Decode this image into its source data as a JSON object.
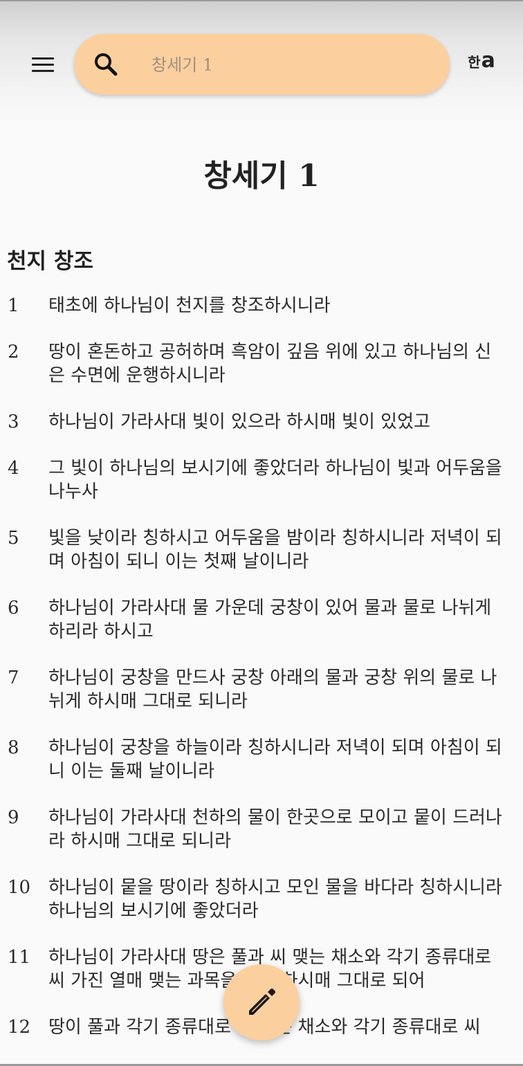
{
  "toolbar": {
    "menu_icon": "hamburger-menu-icon",
    "search_icon": "search-icon",
    "search_placeholder": "창세기 1",
    "lang_toggle_ko": "한",
    "lang_toggle_en": "a"
  },
  "chapter": {
    "title": "창세기 1",
    "section_heading": "천지 창조",
    "verses": [
      {
        "num": "1",
        "text": "태초에 하나님이 천지를 창조하시니라"
      },
      {
        "num": "2",
        "text": "땅이 혼돈하고 공허하며 흑암이 깊음 위에 있고 하나님의 신은 수면에 운행하시니라"
      },
      {
        "num": "3",
        "text": "하나님이 가라사대 빛이 있으라 하시매 빛이 있었고"
      },
      {
        "num": "4",
        "text": "그 빛이 하나님의 보시기에 좋았더라 하나님이 빛과 어두움을 나누사"
      },
      {
        "num": "5",
        "text": "빛을 낮이라 칭하시고 어두움을 밤이라 칭하시니라 저녁이 되며 아침이 되니 이는 첫째 날이니라"
      },
      {
        "num": "6",
        "text": "하나님이 가라사대 물 가운데 궁창이 있어 물과 물로 나뉘게 하리라 하시고"
      },
      {
        "num": "7",
        "text": "하나님이 궁창을 만드사 궁창 아래의 물과 궁창 위의 물로 나뉘게 하시매 그대로 되니라"
      },
      {
        "num": "8",
        "text": "하나님이 궁창을 하늘이라 칭하시니라 저녁이 되며 아침이 되니 이는 둘째 날이니라"
      },
      {
        "num": "9",
        "text": "하나님이 가라사대 천하의 물이 한곳으로 모이고 뭍이 드러나라 하시매 그대로 되니라"
      },
      {
        "num": "10",
        "text": "하나님이 뭍을 땅이라 칭하시고 모인 물을 바다라 칭하시니라 하나님의 보시기에 좋았더라"
      },
      {
        "num": "11",
        "text": "하나님이 가라사대 땅은 풀과 씨 맺는 채소와 각기 종류대로 씨 가진 열매 맺는 과목을 내라 하시매 그대로 되어"
      },
      {
        "num": "12",
        "text": "땅이 풀과 각기 종류대로 씨 맺는 채소와 각기 종류대로 씨"
      }
    ]
  },
  "fab": {
    "icon": "pencil-icon",
    "color": "#fccf9f"
  },
  "colors": {
    "accent": "#fccf9f",
    "background": "#fafafa",
    "text": "#2a2a2a"
  }
}
